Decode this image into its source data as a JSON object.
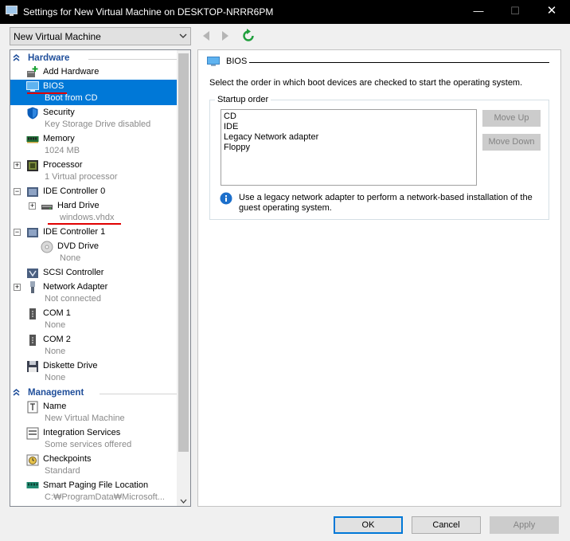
{
  "window": {
    "title": "Settings for New Virtual Machine on DESKTOP-NRRR6PM",
    "minimize_glyph": "—",
    "maximize_glyph": "☐",
    "close_glyph": "✕"
  },
  "vm_selector": {
    "value": "New Virtual Machine"
  },
  "sidebar": {
    "hardware_label": "Hardware",
    "management_label": "Management",
    "hardware_items": [
      {
        "name": "Add Hardware",
        "sub": "",
        "icon": "add-hardware-icon"
      },
      {
        "name": "BIOS",
        "sub": "Boot from CD",
        "icon": "bios-icon",
        "selected": true
      },
      {
        "name": "Security",
        "sub": "Key Storage Drive disabled",
        "icon": "shield-icon"
      },
      {
        "name": "Memory",
        "sub": "1024 MB",
        "icon": "memory-icon"
      },
      {
        "name": "Processor",
        "sub": "1 Virtual processor",
        "icon": "processor-icon"
      },
      {
        "name": "IDE Controller 0",
        "sub": "",
        "icon": "ide-controller-icon"
      },
      {
        "name": "Hard Drive",
        "sub": "windows.vhdx",
        "icon": "hard-drive-icon"
      },
      {
        "name": "IDE Controller 1",
        "sub": "",
        "icon": "ide-controller-icon"
      },
      {
        "name": "DVD Drive",
        "sub": "None",
        "icon": "dvd-icon"
      },
      {
        "name": "SCSI Controller",
        "sub": "",
        "icon": "scsi-controller-icon"
      },
      {
        "name": "Network Adapter",
        "sub": "Not connected",
        "icon": "network-adapter-icon"
      },
      {
        "name": "COM 1",
        "sub": "None",
        "icon": "com-port-icon"
      },
      {
        "name": "COM 2",
        "sub": "None",
        "icon": "com-port-icon"
      },
      {
        "name": "Diskette Drive",
        "sub": "None",
        "icon": "diskette-icon"
      }
    ],
    "management_items": [
      {
        "name": "Name",
        "sub": "New Virtual Machine",
        "icon": "name-icon"
      },
      {
        "name": "Integration Services",
        "sub": "Some services offered",
        "icon": "integration-services-icon"
      },
      {
        "name": "Checkpoints",
        "sub": "Standard",
        "icon": "checkpoints-icon"
      },
      {
        "name": "Smart Paging File Location",
        "sub": "C:₩ProgramData₩Microsoft...",
        "icon": "paging-file-icon"
      }
    ]
  },
  "bios": {
    "header": "BIOS",
    "description": "Select the order in which boot devices are checked to start the operating system.",
    "startup_order_label": "Startup order",
    "boot_devices": [
      "CD",
      "IDE",
      "Legacy Network adapter",
      "Floppy"
    ],
    "move_up_label": "Move Up",
    "move_down_label": "Move Down",
    "info_text": "Use a legacy network adapter to perform a network-based installation of the guest operating system."
  },
  "buttons": {
    "ok": "OK",
    "cancel": "Cancel",
    "apply": "Apply"
  },
  "colors": {
    "selection": "#0078d7",
    "section_header": "#1f4e9a",
    "annotation": "#e00000"
  }
}
